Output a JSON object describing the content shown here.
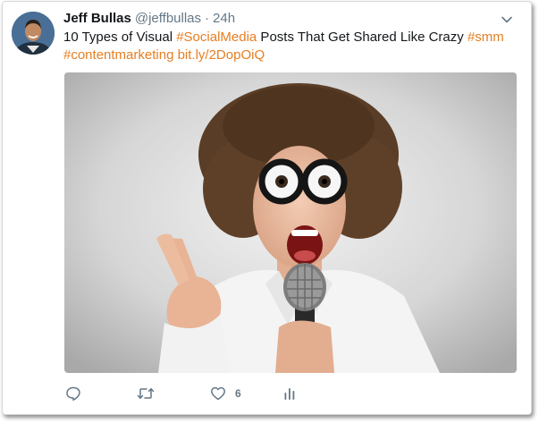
{
  "tweet": {
    "author_name": "Jeff Bullas",
    "author_handle": "@jeffbullas",
    "separator": "·",
    "time": "24h",
    "text_plain_1": "10 Types of Visual ",
    "hashtag_1": "#SocialMedia",
    "text_plain_2": " Posts That Get Shared Like Crazy ",
    "hashtag_2": "#smm",
    "hashtag_3": "#contentmarketing",
    "link": "bit.ly/2DopOiQ"
  },
  "actions": {
    "reply_icon": "reply-icon",
    "retweet_icon": "retweet-icon",
    "like_icon": "heart-icon",
    "like_count": "6",
    "analytics_icon": "analytics-icon"
  },
  "colors": {
    "link": "#e67e22",
    "muted": "#657786",
    "text": "#14171a"
  }
}
